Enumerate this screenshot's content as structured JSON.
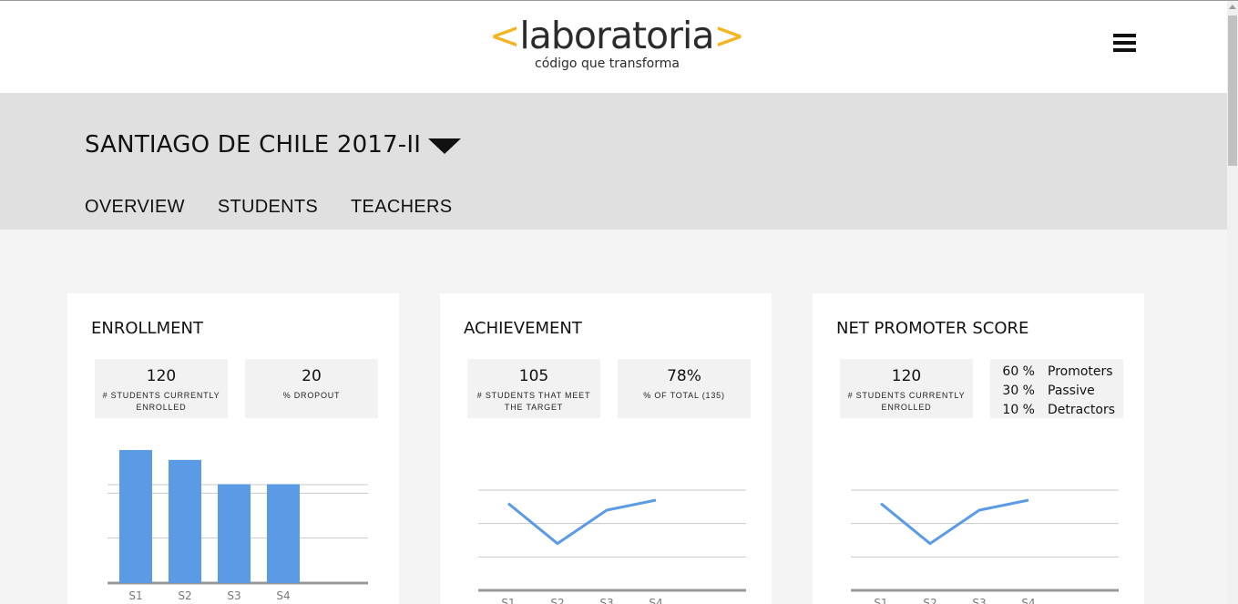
{
  "brand": {
    "name": "laboratoria",
    "open_bracket": "<",
    "close_bracket": ">",
    "tagline": "código que transforma",
    "accent_color": "#f5b31f"
  },
  "nav": {
    "menu_icon": "hamburger-menu-icon"
  },
  "cohort": {
    "title": "SANTIAGO DE CHILE 2017-II",
    "dropdown_icon": "caret-down-icon"
  },
  "tabs": [
    {
      "label": "OVERVIEW"
    },
    {
      "label": "STUDENTS"
    },
    {
      "label": "TEACHERS"
    }
  ],
  "cards": {
    "enrollment": {
      "title": "ENROLLMENT",
      "stats": [
        {
          "value": "120",
          "label": "# STUDENTS CURRENTLY ENROLLED"
        },
        {
          "value": "20",
          "label": "% DROPOUT"
        }
      ]
    },
    "achievement": {
      "title": "ACHIEVEMENT",
      "stats": [
        {
          "value": "105",
          "label": "# STUDENTS THAT MEET THE TARGET"
        },
        {
          "value": "78%",
          "label": "% OF TOTAL (135)"
        }
      ]
    },
    "nps": {
      "title": "NET PROMOTER SCORE",
      "stat": {
        "value": "120",
        "label": "# STUDENTS CURRENTLY ENROLLED"
      },
      "breakdown": [
        {
          "pct": "60 %",
          "name": "Promoters"
        },
        {
          "pct": "30 %",
          "name": "Passive"
        },
        {
          "pct": "10 %",
          "name": "Detractors"
        }
      ]
    }
  },
  "chart_data": [
    {
      "type": "bar",
      "categories": [
        "S1",
        "S2",
        "S3",
        "S4"
      ],
      "values": [
        148,
        137,
        110,
        110
      ],
      "ylim": [
        0,
        150
      ],
      "grid": true,
      "color": "#5b9be6"
    },
    {
      "type": "line",
      "categories": [
        "S1",
        "S2",
        "S3",
        "S4"
      ],
      "values": [
        2.6,
        1.4,
        2.4,
        2.7
      ],
      "ylim": [
        0,
        3
      ],
      "grid": true,
      "color": "#5b9be6"
    },
    {
      "type": "line",
      "categories": [
        "S1",
        "S2",
        "S3",
        "S4"
      ],
      "values": [
        2.6,
        1.4,
        2.4,
        2.7
      ],
      "ylim": [
        0,
        3
      ],
      "grid": true,
      "color": "#5b9be6"
    }
  ]
}
